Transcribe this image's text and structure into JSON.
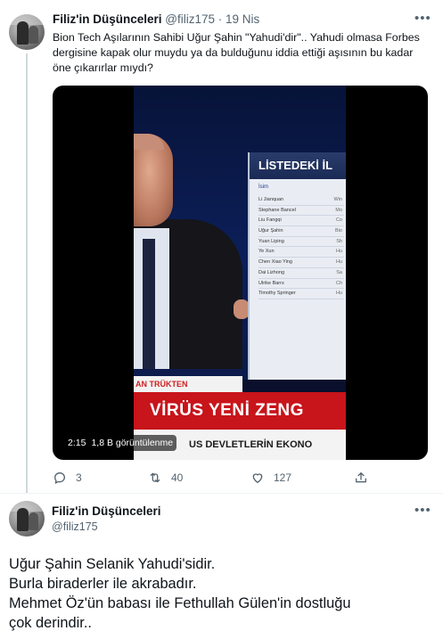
{
  "tweet1": {
    "author_name": "Filiz'in Düşünceleri",
    "handle": "@filiz175",
    "separator": "·",
    "date": "19 Nis",
    "more_icon": "more-horizontal-icon",
    "text": "Bion Tech Aşılarının  Sahibi Uğur Şahin \"Yahudi'dir\".. Yahudi olmasa Forbes dergisine kapak olur muydu ya da bulduğunu iddia ettiği aşısının bu kadar öne çıkarırlar mıydı?",
    "video": {
      "duration": "2:15",
      "views": "1,8 B görüntülenme",
      "panel_title": "LİSTEDEKİ İL",
      "panel_subtitle": "İsim",
      "panel_rows": [
        {
          "name": "Li Jianquan",
          "value": "Win"
        },
        {
          "name": "Stephane Bancel",
          "value": "Mo"
        },
        {
          "name": "Liu Fangqi",
          "value": "Co"
        },
        {
          "name": "Uğur Şahin",
          "value": "Bio"
        },
        {
          "name": "Yuan Liping",
          "value": "Sh"
        },
        {
          "name": "Ye Xun",
          "value": "Hu"
        },
        {
          "name": "Chen Xiao Ying",
          "value": "Hu"
        },
        {
          "name": "Dai Lizhong",
          "value": "Sa"
        },
        {
          "name": "Ulrike Barrs",
          "value": "Ch"
        },
        {
          "name": "Timothy Springer",
          "value": "Hu"
        }
      ],
      "chyron_top": "AN TRÜKTEN",
      "chyron_main": "VİRÜS YENİ ZENG",
      "chyron_sub": "US DEVLETLERİN EKONO"
    },
    "actions": {
      "reply_count": "3",
      "retweet_count": "40",
      "like_count": "127",
      "reply_icon": "reply-icon",
      "retweet_icon": "retweet-icon",
      "like_icon": "like-icon",
      "share_icon": "share-icon"
    }
  },
  "tweet2": {
    "author_name": "Filiz'in Düşünceleri",
    "handle": "@filiz175",
    "more_icon": "more-horizontal-icon",
    "lines": [
      "Uğur Şahin Selanik Yahudi'sidir.",
      "Burla biraderler ile akrabadır.",
      "Mehmet Öz'ün babası ile Fethullah Gülen'in dostluğu",
      "çok derindir.."
    ]
  },
  "colors": {
    "text_primary": "#0f1419",
    "text_secondary": "#536471",
    "thread_line": "#cfd9de",
    "chyron_red": "#c8141b"
  }
}
